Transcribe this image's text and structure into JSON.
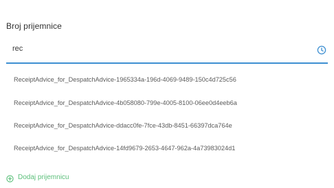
{
  "form": {
    "label": "Broj prijemnice",
    "search_value": "rec"
  },
  "dropdown": {
    "options": [
      "ReceiptAdvice_for_DespatchAdvice-1965334a-196d-4069-9489-150c4d725c56",
      "ReceiptAdvice_for_DespatchAdvice-4b058080-799e-4005-8100-06ee0d4eeb6a",
      "ReceiptAdvice_for_DespatchAdvice-ddacc0fe-7fce-43db-8451-66397dca764e",
      "ReceiptAdvice_for_DespatchAdvice-14fd9679-2653-4647-962a-4a73983024d1"
    ]
  },
  "actions": {
    "add_label": "Dodaj prijemnicu"
  },
  "icons": {
    "input_icon": "clock-icon",
    "add_icon": "plus-circle-icon"
  },
  "colors": {
    "accent": "#3d8fd1",
    "add_green": "#5bbf7a"
  }
}
